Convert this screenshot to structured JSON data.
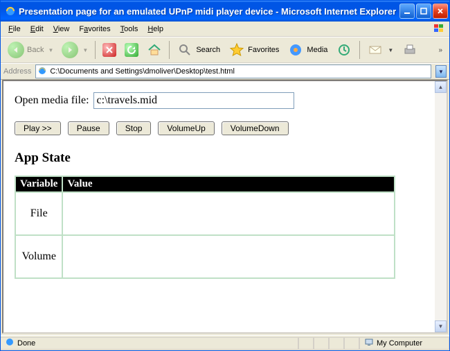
{
  "window": {
    "title": "Presentation page for an emulated UPnP midi player device - Microsoft Internet Explorer"
  },
  "menubar": {
    "file": "File",
    "edit": "Edit",
    "view": "View",
    "favorites": "Favorites",
    "tools": "Tools",
    "help": "Help"
  },
  "toolbar": {
    "back": "Back",
    "search": "Search",
    "favorites": "Favorites",
    "media": "Media"
  },
  "address": {
    "label": "Address",
    "value": "C:\\Documents and Settings\\dmoliver\\Desktop\\test.html"
  },
  "page": {
    "open_label": "Open media file:",
    "open_value": "c:\\travels.mid",
    "buttons": {
      "play": "Play >>",
      "pause": "Pause",
      "stop": "Stop",
      "volup": "VolumeUp",
      "voldown": "VolumeDown"
    },
    "heading": "App State",
    "table": {
      "col_variable": "Variable",
      "col_value": "Value",
      "rows": [
        {
          "variable": "File",
          "value": ""
        },
        {
          "variable": "Volume",
          "value": ""
        }
      ]
    }
  },
  "status": {
    "text": "Done",
    "zone": "My Computer"
  }
}
